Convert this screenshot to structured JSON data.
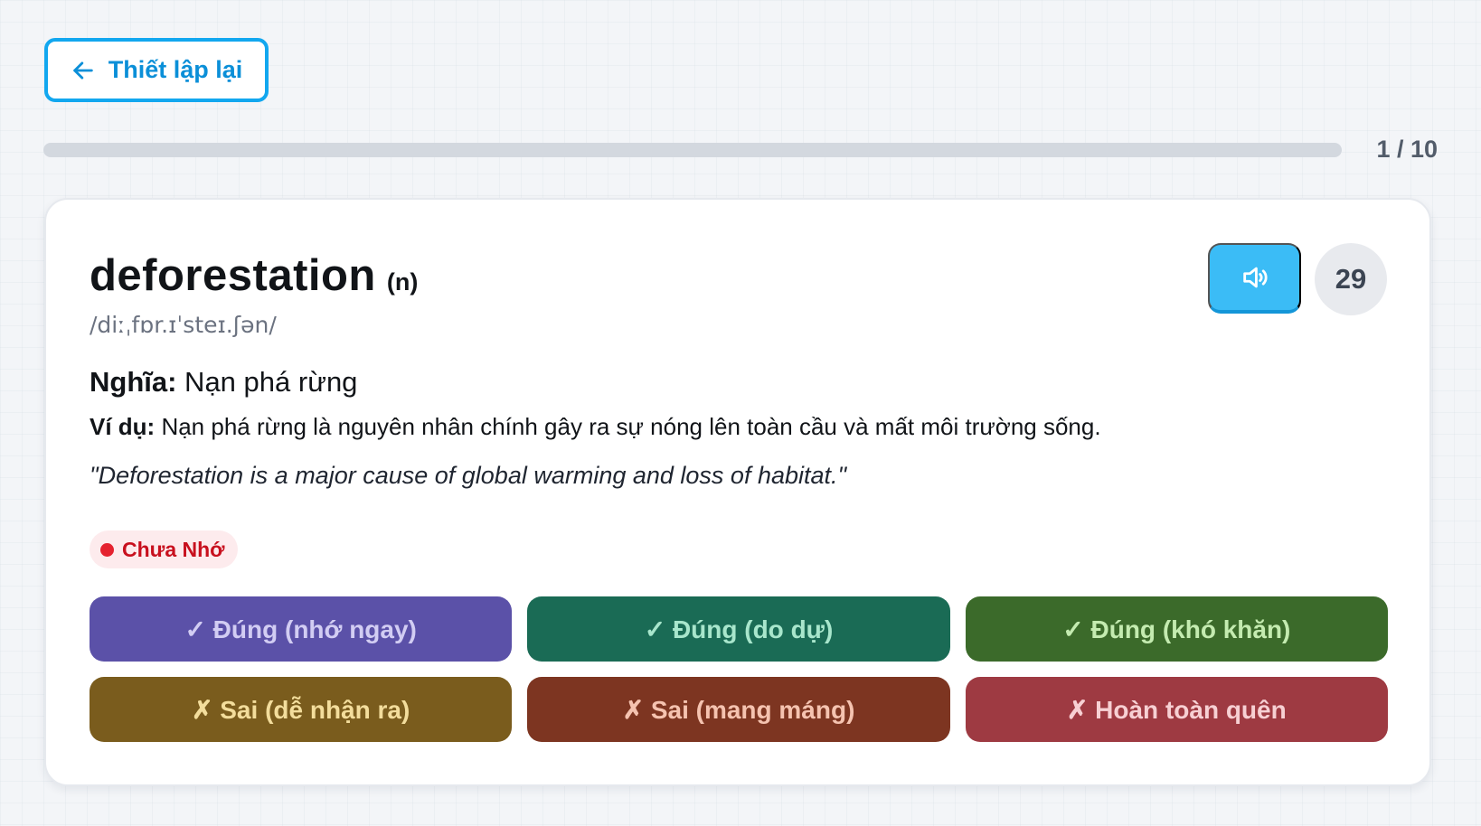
{
  "header": {
    "back_label": "Thiết lập lại"
  },
  "progress": {
    "text": "1 / 10",
    "fraction": 0.0
  },
  "card": {
    "word": "deforestation",
    "part_of_speech": "(n)",
    "ipa": "/diːˌfɒr.ɪˈsteɪ.ʃən/",
    "meaning_label": "Nghĩa:",
    "meaning": " Nạn phá rừng",
    "example_label": "Ví dụ:",
    "example": " Nạn phá rừng là nguyên nhân chính gây ra sự nóng lên toàn cầu và mất môi trường sống.",
    "quote": "\"Deforestation is a major cause of global warming and loss of habitat.\"",
    "count": "29",
    "sound_icon": "speaker-icon",
    "status": "Chưa Nhớ"
  },
  "answers": [
    {
      "label": "✓ Đúng (nhớ ngay)",
      "bg": "#5b51a8",
      "fg": "#d2cdf3"
    },
    {
      "label": "✓ Đúng (do dự)",
      "bg": "#1a6b55",
      "fg": "#a8e6cc"
    },
    {
      "label": "✓ Đúng (khó khăn)",
      "bg": "#3b6a2a",
      "fg": "#c4ebb0"
    },
    {
      "label": "✗ Sai (dễ nhận ra)",
      "bg": "#7a5c1d",
      "fg": "#f3dd9c"
    },
    {
      "label": "✗ Sai (mang máng)",
      "bg": "#7d3521",
      "fg": "#f5c3b0"
    },
    {
      "label": "✗ Hoàn toàn quên",
      "bg": "#9e3a42",
      "fg": "#f7d0d3"
    }
  ],
  "colors": {
    "accent": "#12a7ef",
    "status_red": "#e5222f"
  }
}
